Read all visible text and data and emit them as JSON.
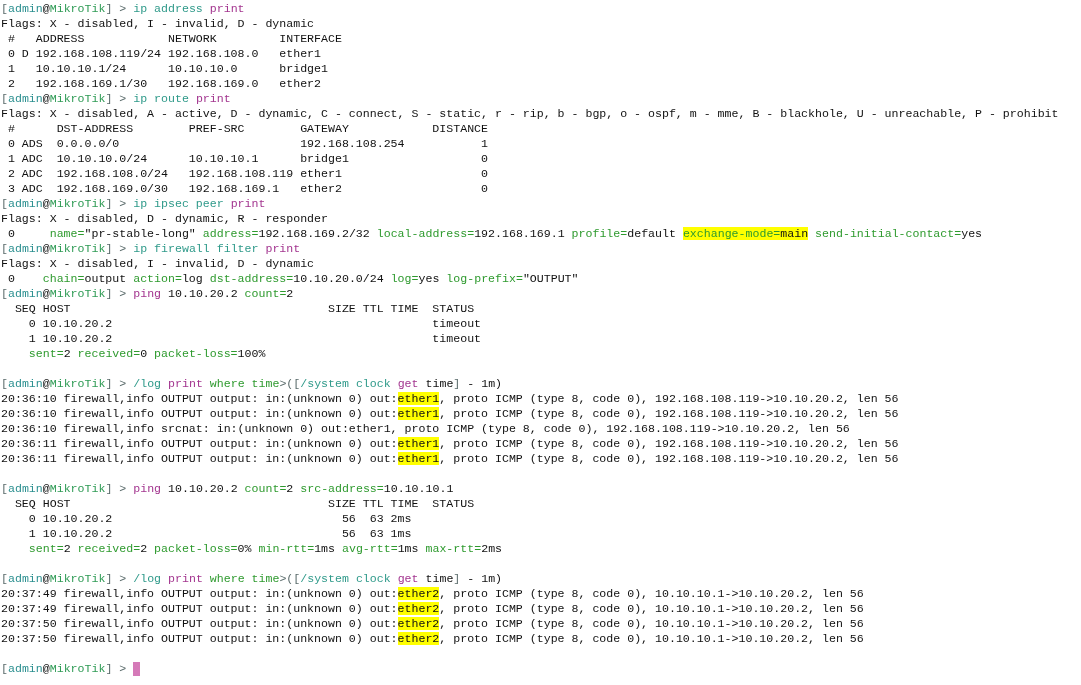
{
  "terminal": {
    "lines": [
      {
        "kind": "command",
        "segments": [
          {
            "text": "[",
            "kind": "punct"
          },
          {
            "text": "admin",
            "kind": "user"
          },
          {
            "text": "@",
            "kind": "text"
          },
          {
            "text": "MikroTik",
            "kind": "host"
          },
          {
            "text": "] > ",
            "kind": "punct"
          },
          {
            "text": "ip address",
            "kind": "path"
          },
          {
            "text": " print",
            "kind": "verb"
          }
        ]
      },
      {
        "kind": "output",
        "segments": [
          {
            "text": "Flags: X - disabled, I - invalid, D - dynamic",
            "kind": "text"
          }
        ]
      },
      {
        "kind": "output",
        "segments": [
          {
            "text": " #   ADDRESS            NETWORK         INTERFACE",
            "kind": "text"
          }
        ]
      },
      {
        "kind": "output",
        "segments": [
          {
            "text": " 0 D 192.168.108.119/24 192.168.108.0   ether1",
            "kind": "text"
          }
        ]
      },
      {
        "kind": "output",
        "segments": [
          {
            "text": " 1   10.10.10.1/24      10.10.10.0      bridge1",
            "kind": "text"
          }
        ]
      },
      {
        "kind": "output",
        "segments": [
          {
            "text": " 2   192.168.169.1/30   192.168.169.0   ether2",
            "kind": "text"
          }
        ]
      },
      {
        "kind": "command",
        "segments": [
          {
            "text": "[",
            "kind": "punct"
          },
          {
            "text": "admin",
            "kind": "user"
          },
          {
            "text": "@",
            "kind": "text"
          },
          {
            "text": "MikroTik",
            "kind": "host"
          },
          {
            "text": "] > ",
            "kind": "punct"
          },
          {
            "text": "ip route",
            "kind": "path"
          },
          {
            "text": " print",
            "kind": "verb"
          }
        ]
      },
      {
        "kind": "output",
        "segments": [
          {
            "text": "Flags: X - disabled, A - active, D - dynamic, C - connect, S - static, r - rip, b - bgp, o - ospf, m - mme, B - blackhole, U - unreachable, P - prohibit",
            "kind": "text"
          }
        ]
      },
      {
        "kind": "output",
        "segments": [
          {
            "text": " #      DST-ADDRESS        PREF-SRC        GATEWAY            DISTANCE",
            "kind": "text"
          }
        ]
      },
      {
        "kind": "output",
        "segments": [
          {
            "text": " 0 ADS  0.0.0.0/0                          192.168.108.254           1",
            "kind": "text"
          }
        ]
      },
      {
        "kind": "output",
        "segments": [
          {
            "text": " 1 ADC  10.10.10.0/24      10.10.10.1      bridge1                   0",
            "kind": "text"
          }
        ]
      },
      {
        "kind": "output",
        "segments": [
          {
            "text": " 2 ADC  192.168.108.0/24   192.168.108.119 ether1                    0",
            "kind": "text"
          }
        ]
      },
      {
        "kind": "output",
        "segments": [
          {
            "text": " 3 ADC  192.168.169.0/30   192.168.169.1   ether2                    0",
            "kind": "text"
          }
        ]
      },
      {
        "kind": "command",
        "segments": [
          {
            "text": "[",
            "kind": "punct"
          },
          {
            "text": "admin",
            "kind": "user"
          },
          {
            "text": "@",
            "kind": "text"
          },
          {
            "text": "MikroTik",
            "kind": "host"
          },
          {
            "text": "] > ",
            "kind": "punct"
          },
          {
            "text": "ip ipsec peer",
            "kind": "path"
          },
          {
            "text": " print",
            "kind": "verb"
          }
        ]
      },
      {
        "kind": "output",
        "segments": [
          {
            "text": "Flags: X - disabled, D - dynamic, R - responder",
            "kind": "text"
          }
        ]
      },
      {
        "kind": "output",
        "segments": [
          {
            "text": " 0     ",
            "kind": "text"
          },
          {
            "text": "name=",
            "kind": "key"
          },
          {
            "text": "\"pr-stable-long\" ",
            "kind": "text"
          },
          {
            "text": "address=",
            "kind": "key"
          },
          {
            "text": "192.168.169.2/32 ",
            "kind": "text"
          },
          {
            "text": "local-address=",
            "kind": "key"
          },
          {
            "text": "192.168.169.1 ",
            "kind": "text"
          },
          {
            "text": "profile=",
            "kind": "key"
          },
          {
            "text": "default ",
            "kind": "text"
          },
          {
            "text": "exchange-mode=",
            "kind": "marked-key"
          },
          {
            "text": "main",
            "kind": "marked"
          },
          {
            "text": " send-initial-contact=",
            "kind": "key"
          },
          {
            "text": "yes",
            "kind": "text"
          }
        ]
      },
      {
        "kind": "command",
        "segments": [
          {
            "text": "[",
            "kind": "punct"
          },
          {
            "text": "admin",
            "kind": "user"
          },
          {
            "text": "@",
            "kind": "text"
          },
          {
            "text": "MikroTik",
            "kind": "host"
          },
          {
            "text": "] > ",
            "kind": "punct"
          },
          {
            "text": "ip firewall filter",
            "kind": "path"
          },
          {
            "text": " print",
            "kind": "verb"
          }
        ]
      },
      {
        "kind": "output",
        "segments": [
          {
            "text": "Flags: X - disabled, I - invalid, D - dynamic",
            "kind": "text"
          }
        ]
      },
      {
        "kind": "output",
        "segments": [
          {
            "text": " 0    ",
            "kind": "text"
          },
          {
            "text": "chain=",
            "kind": "key"
          },
          {
            "text": "output ",
            "kind": "text"
          },
          {
            "text": "action=",
            "kind": "key"
          },
          {
            "text": "log ",
            "kind": "text"
          },
          {
            "text": "dst-address=",
            "kind": "key"
          },
          {
            "text": "10.10.20.0/24 ",
            "kind": "text"
          },
          {
            "text": "log=",
            "kind": "key"
          },
          {
            "text": "yes ",
            "kind": "text"
          },
          {
            "text": "log-prefix=",
            "kind": "key"
          },
          {
            "text": "\"OUTPUT\"",
            "kind": "text"
          }
        ]
      },
      {
        "kind": "command",
        "segments": [
          {
            "text": "[",
            "kind": "punct"
          },
          {
            "text": "admin",
            "kind": "user"
          },
          {
            "text": "@",
            "kind": "text"
          },
          {
            "text": "MikroTik",
            "kind": "host"
          },
          {
            "text": "] > ",
            "kind": "punct"
          },
          {
            "text": "ping",
            "kind": "verb"
          },
          {
            "text": " 10.10.20.2 ",
            "kind": "text"
          },
          {
            "text": "count=",
            "kind": "key"
          },
          {
            "text": "2",
            "kind": "text"
          }
        ]
      },
      {
        "kind": "output",
        "segments": [
          {
            "text": "  SEQ HOST                                     SIZE TTL TIME  STATUS",
            "kind": "text"
          }
        ]
      },
      {
        "kind": "output",
        "segments": [
          {
            "text": "    0 10.10.20.2                                              timeout",
            "kind": "text"
          }
        ]
      },
      {
        "kind": "output",
        "segments": [
          {
            "text": "    1 10.10.20.2                                              timeout",
            "kind": "text"
          }
        ]
      },
      {
        "kind": "output",
        "segments": [
          {
            "text": "    sent=",
            "kind": "key"
          },
          {
            "text": "2 ",
            "kind": "text"
          },
          {
            "text": "received=",
            "kind": "key"
          },
          {
            "text": "0 ",
            "kind": "text"
          },
          {
            "text": "packet-loss=",
            "kind": "key"
          },
          {
            "text": "100%",
            "kind": "text"
          }
        ]
      },
      {
        "kind": "blank"
      },
      {
        "kind": "command",
        "segments": [
          {
            "text": "[",
            "kind": "punct"
          },
          {
            "text": "admin",
            "kind": "user"
          },
          {
            "text": "@",
            "kind": "text"
          },
          {
            "text": "MikroTik",
            "kind": "host"
          },
          {
            "text": "] > ",
            "kind": "punct"
          },
          {
            "text": "/log",
            "kind": "path"
          },
          {
            "text": " print",
            "kind": "verb"
          },
          {
            "text": " where time",
            "kind": "key"
          },
          {
            "text": ">([",
            "kind": "punct"
          },
          {
            "text": "/system clock",
            "kind": "path"
          },
          {
            "text": " get",
            "kind": "verb"
          },
          {
            "text": " time",
            "kind": "text"
          },
          {
            "text": "]",
            "kind": "punct"
          },
          {
            "text": " - 1m)",
            "kind": "text"
          }
        ]
      },
      {
        "kind": "output",
        "segments": [
          {
            "text": "20:36:10 firewall,info OUTPUT output: in:(unknown 0) out:",
            "kind": "text"
          },
          {
            "text": "ether1",
            "kind": "marked"
          },
          {
            "text": ", proto ICMP (type 8, code 0), 192.168.108.119->10.10.20.2, len 56",
            "kind": "text"
          }
        ]
      },
      {
        "kind": "output",
        "segments": [
          {
            "text": "20:36:10 firewall,info OUTPUT output: in:(unknown 0) out:",
            "kind": "text"
          },
          {
            "text": "ether1",
            "kind": "marked"
          },
          {
            "text": ", proto ICMP (type 8, code 0), 192.168.108.119->10.10.20.2, len 56",
            "kind": "text"
          }
        ]
      },
      {
        "kind": "output",
        "segments": [
          {
            "text": "20:36:10 firewall,info srcnat: in:(unknown 0) out:ether1, proto ICMP (type 8, code 0), 192.168.108.119->10.10.20.2, len 56",
            "kind": "text"
          }
        ]
      },
      {
        "kind": "output",
        "segments": [
          {
            "text": "20:36:11 firewall,info OUTPUT output: in:(unknown 0) out:",
            "kind": "text"
          },
          {
            "text": "ether1",
            "kind": "marked"
          },
          {
            "text": ", proto ICMP (type 8, code 0), 192.168.108.119->10.10.20.2, len 56",
            "kind": "text"
          }
        ]
      },
      {
        "kind": "output",
        "segments": [
          {
            "text": "20:36:11 firewall,info OUTPUT output: in:(unknown 0) out:",
            "kind": "text"
          },
          {
            "text": "ether1",
            "kind": "marked"
          },
          {
            "text": ", proto ICMP (type 8, code 0), 192.168.108.119->10.10.20.2, len 56",
            "kind": "text"
          }
        ]
      },
      {
        "kind": "blank"
      },
      {
        "kind": "command",
        "segments": [
          {
            "text": "[",
            "kind": "punct"
          },
          {
            "text": "admin",
            "kind": "user"
          },
          {
            "text": "@",
            "kind": "text"
          },
          {
            "text": "MikroTik",
            "kind": "host"
          },
          {
            "text": "] > ",
            "kind": "punct"
          },
          {
            "text": "ping",
            "kind": "verb"
          },
          {
            "text": " 10.10.20.2 ",
            "kind": "text"
          },
          {
            "text": "count=",
            "kind": "key"
          },
          {
            "text": "2 ",
            "kind": "text"
          },
          {
            "text": "src-address=",
            "kind": "key"
          },
          {
            "text": "10.10.10.1",
            "kind": "text"
          }
        ]
      },
      {
        "kind": "output",
        "segments": [
          {
            "text": "  SEQ HOST                                     SIZE TTL TIME  STATUS",
            "kind": "text"
          }
        ]
      },
      {
        "kind": "output",
        "segments": [
          {
            "text": "    0 10.10.20.2                                 56  63 2ms",
            "kind": "text"
          }
        ]
      },
      {
        "kind": "output",
        "segments": [
          {
            "text": "    1 10.10.20.2                                 56  63 1ms",
            "kind": "text"
          }
        ]
      },
      {
        "kind": "output",
        "segments": [
          {
            "text": "    sent=",
            "kind": "key"
          },
          {
            "text": "2 ",
            "kind": "text"
          },
          {
            "text": "received=",
            "kind": "key"
          },
          {
            "text": "2 ",
            "kind": "text"
          },
          {
            "text": "packet-loss=",
            "kind": "key"
          },
          {
            "text": "0% ",
            "kind": "text"
          },
          {
            "text": "min-rtt=",
            "kind": "key"
          },
          {
            "text": "1ms ",
            "kind": "text"
          },
          {
            "text": "avg-rtt=",
            "kind": "key"
          },
          {
            "text": "1ms ",
            "kind": "text"
          },
          {
            "text": "max-rtt=",
            "kind": "key"
          },
          {
            "text": "2ms",
            "kind": "text"
          }
        ]
      },
      {
        "kind": "blank"
      },
      {
        "kind": "command",
        "segments": [
          {
            "text": "[",
            "kind": "punct"
          },
          {
            "text": "admin",
            "kind": "user"
          },
          {
            "text": "@",
            "kind": "text"
          },
          {
            "text": "MikroTik",
            "kind": "host"
          },
          {
            "text": "] > ",
            "kind": "punct"
          },
          {
            "text": "/log",
            "kind": "path"
          },
          {
            "text": " print",
            "kind": "verb"
          },
          {
            "text": " where time",
            "kind": "key"
          },
          {
            "text": ">([",
            "kind": "punct"
          },
          {
            "text": "/system clock",
            "kind": "path"
          },
          {
            "text": " get",
            "kind": "verb"
          },
          {
            "text": " time",
            "kind": "text"
          },
          {
            "text": "]",
            "kind": "punct"
          },
          {
            "text": " - 1m)",
            "kind": "text"
          }
        ]
      },
      {
        "kind": "output",
        "segments": [
          {
            "text": "20:37:49 firewall,info OUTPUT output: in:(unknown 0) out:",
            "kind": "text"
          },
          {
            "text": "ether2",
            "kind": "marked"
          },
          {
            "text": ", proto ICMP (type 8, code 0), 10.10.10.1->10.10.20.2, len 56",
            "kind": "text"
          }
        ]
      },
      {
        "kind": "output",
        "segments": [
          {
            "text": "20:37:49 firewall,info OUTPUT output: in:(unknown 0) out:",
            "kind": "text"
          },
          {
            "text": "ether2",
            "kind": "marked"
          },
          {
            "text": ", proto ICMP (type 8, code 0), 10.10.10.1->10.10.20.2, len 56",
            "kind": "text"
          }
        ]
      },
      {
        "kind": "output",
        "segments": [
          {
            "text": "20:37:50 firewall,info OUTPUT output: in:(unknown 0) out:",
            "kind": "text"
          },
          {
            "text": "ether2",
            "kind": "marked"
          },
          {
            "text": ", proto ICMP (type 8, code 0), 10.10.10.1->10.10.20.2, len 56",
            "kind": "text"
          }
        ]
      },
      {
        "kind": "output",
        "segments": [
          {
            "text": "20:37:50 firewall,info OUTPUT output: in:(unknown 0) out:",
            "kind": "text"
          },
          {
            "text": "ether2",
            "kind": "marked"
          },
          {
            "text": ", proto ICMP (type 8, code 0), 10.10.10.1->10.10.20.2, len 56",
            "kind": "text"
          }
        ]
      },
      {
        "kind": "blank"
      },
      {
        "kind": "input",
        "segments": [
          {
            "text": "[",
            "kind": "punct"
          },
          {
            "text": "admin",
            "kind": "user"
          },
          {
            "text": "@",
            "kind": "text"
          },
          {
            "text": "MikroTik",
            "kind": "host"
          },
          {
            "text": "] > ",
            "kind": "punct"
          }
        ]
      }
    ]
  }
}
